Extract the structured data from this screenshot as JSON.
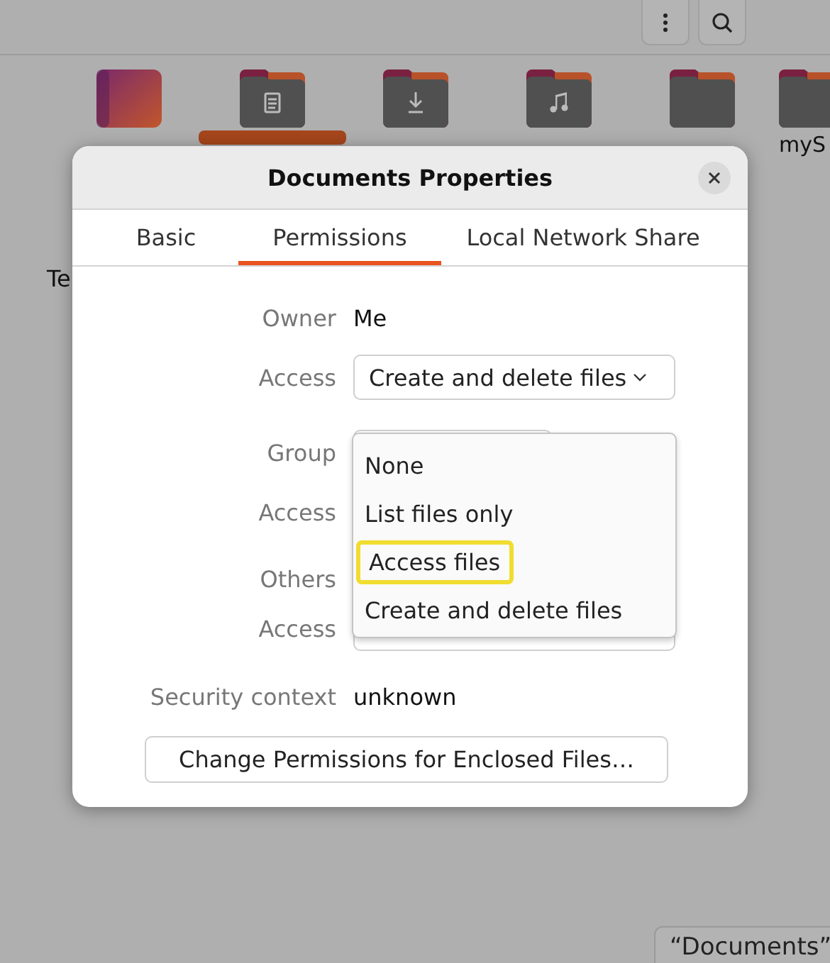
{
  "files": [
    {
      "kind": "desktop",
      "selected": false
    },
    {
      "kind": "documents",
      "selected": true
    },
    {
      "kind": "downloads",
      "selected": false
    },
    {
      "kind": "music",
      "selected": false
    },
    {
      "kind": "folder",
      "selected": false
    },
    {
      "kind": "folder",
      "label": "myS"
    }
  ],
  "second_row": [
    {
      "label": "Te"
    }
  ],
  "dialog": {
    "title": "Documents Properties",
    "tabs": [
      {
        "label": "Basic",
        "selected": false
      },
      {
        "label": "Permissions",
        "selected": true
      },
      {
        "label": "Local Network Share",
        "selected": false
      }
    ],
    "owner": {
      "label": "Owner",
      "value": "Me"
    },
    "owner_access": {
      "label": "Access",
      "value": "Create and delete files"
    },
    "group": {
      "label": "Group"
    },
    "group_access": {
      "label": "Access"
    },
    "others": {
      "label": "Others"
    },
    "others_access": {
      "label": "Access"
    },
    "security_context": {
      "label": "Security context",
      "value": "unknown"
    },
    "button": "Change Permissions for Enclosed Files…"
  },
  "access_menu": [
    {
      "label": "None",
      "selected": false
    },
    {
      "label": "List files only",
      "selected": false
    },
    {
      "label": "Access files",
      "selected": true
    },
    {
      "label": "Create and delete files",
      "selected": false
    }
  ],
  "status": "“Documents”"
}
